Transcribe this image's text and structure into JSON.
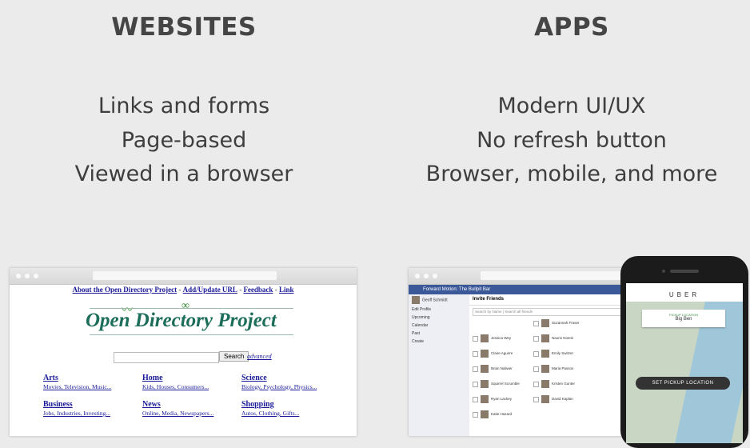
{
  "left": {
    "heading": "WEBSITES",
    "lines": [
      "Links and forms",
      "Page-based",
      "Viewed in a browser"
    ]
  },
  "right": {
    "heading": "APPS",
    "lines": [
      "Modern UI/UX",
      "No refresh button",
      "Browser, mobile, and more"
    ]
  },
  "odp": {
    "links": [
      "About the Open Directory Project",
      "Add/Update URL",
      "Feedback",
      "Link"
    ],
    "separator": "-",
    "logo": "Open Directory Project",
    "search_button": "Search",
    "advanced": "advanced",
    "categories": [
      {
        "title": "Arts",
        "sub": "Movies, Television, Music..."
      },
      {
        "title": "Home",
        "sub": "Kids, Houses, Consumers..."
      },
      {
        "title": "Science",
        "sub": "Biology, Psychology, Physics..."
      },
      {
        "title": "Business",
        "sub": "Jobs, Industries, Investing..."
      },
      {
        "title": "News",
        "sub": "Online, Media, Newspapers..."
      },
      {
        "title": "Shopping",
        "sub": "Autos, Clothing, Gifts..."
      }
    ]
  },
  "fb": {
    "title": "Forward Motion: The Bullpit Bar",
    "user": "Geoff Schmidt",
    "edit": "Edit Profile",
    "side_items": [
      "Upcoming",
      "Calendar",
      "Past",
      "Create"
    ],
    "invite": "Invite Friends",
    "search_by": "Search by Name",
    "search_placeholder": "Search all friends",
    "friends": [
      "Jessica Wey",
      "Naomi Noemi",
      "Claire Aguirre",
      "Emily Switzer",
      "Brian Naliwer",
      "Maria Passos",
      "Squirrel Scrumble",
      "Kristen Gunter",
      "Ryan Lackey",
      "David Kaplan",
      "Katie Hazard",
      "Suzannah Fraser"
    ]
  },
  "uber": {
    "brand": "UBER",
    "pickup_label": "PICKUP LOCATION",
    "pickup_place": "Big Ben",
    "set_pickup": "SET PICKUP LOCATION"
  }
}
